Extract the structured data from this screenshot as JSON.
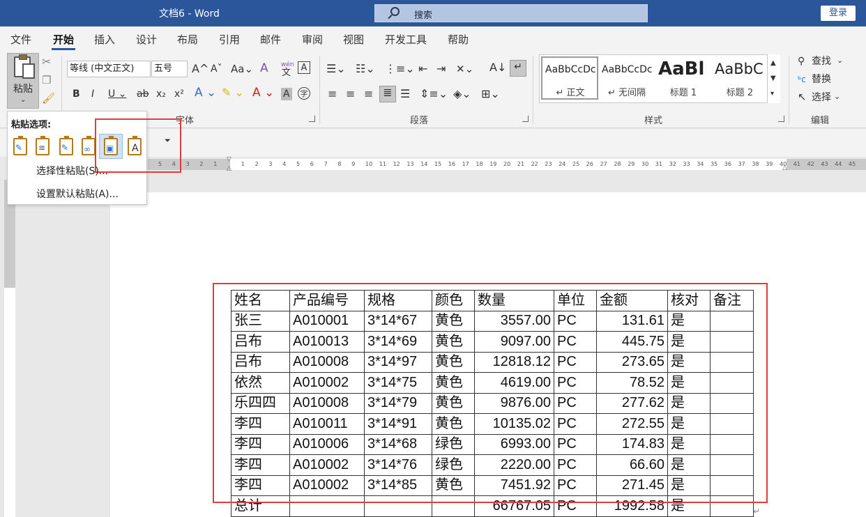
{
  "titlebar": {
    "title": "文档6  -  Word",
    "search_placeholder": "搜索",
    "login": "登录"
  },
  "tabs": [
    "文件",
    "开始",
    "插入",
    "设计",
    "布局",
    "引用",
    "邮件",
    "审阅",
    "视图",
    "开发工具",
    "帮助"
  ],
  "active_tab": "开始",
  "ribbon": {
    "paste_label": "粘贴",
    "font_name": "等线 (中文正文)",
    "font_size": "五号",
    "group_font": "字体",
    "group_paragraph": "段落",
    "group_styles": "样式",
    "group_edit": "编辑",
    "styles": [
      {
        "preview": "AaBbCcDc",
        "name": "↵ 正文"
      },
      {
        "preview": "AaBbCcDc",
        "name": "↵ 无间隔"
      },
      {
        "preview": "AaBl",
        "name": "标题 1"
      },
      {
        "preview": "AaBbC",
        "name": "标题 2"
      }
    ],
    "find": "查找",
    "replace": "替换",
    "select": "选择",
    "wen_label": "wén",
    "wen_char": "文"
  },
  "paste_menu": {
    "title": "粘贴选项:",
    "item_special": "选择性粘贴(S)...",
    "item_default": "设置默认粘贴(A)..."
  },
  "table": {
    "headers": [
      "姓名",
      "产品编号",
      "规格",
      "颜色",
      "数量",
      "单位",
      "金额",
      "核对",
      "备注"
    ],
    "rows": [
      [
        "张三",
        "A010001",
        "3*14*67",
        "黄色",
        "3557.00",
        "PC",
        "131.61",
        "是",
        ""
      ],
      [
        "吕布",
        "A010013",
        "3*14*69",
        "黄色",
        "9097.00",
        "PC",
        "445.75",
        "是",
        ""
      ],
      [
        "吕布",
        "A010008",
        "3*14*97",
        "黄色",
        "12818.12",
        "PC",
        "273.65",
        "是",
        ""
      ],
      [
        "依然",
        "A010002",
        "3*14*75",
        "黄色",
        "4619.00",
        "PC",
        "78.52",
        "是",
        ""
      ],
      [
        "乐四四",
        "A010008",
        "3*14*79",
        "黄色",
        "9876.00",
        "PC",
        "277.62",
        "是",
        ""
      ],
      [
        "李四",
        "A010011",
        "3*14*91",
        "黄色",
        "10135.02",
        "PC",
        "272.55",
        "是",
        ""
      ],
      [
        "李四",
        "A010006",
        "3*14*68",
        "绿色",
        "6993.00",
        "PC",
        "174.83",
        "是",
        ""
      ],
      [
        "李四",
        "A010002",
        "3*14*76",
        "绿色",
        "2220.00",
        "PC",
        "66.60",
        "是",
        ""
      ],
      [
        "李四",
        "A010002",
        "3*14*85",
        "黄色",
        "7451.92",
        "PC",
        "271.45",
        "是",
        ""
      ],
      [
        "总计",
        "",
        "",
        "",
        "66767.05",
        "PC",
        "1992.58",
        "是",
        ""
      ]
    ]
  },
  "colors": {
    "titlebar": "#2b579a",
    "highlight_box": "#e03c3c",
    "accent": "#2b579a"
  }
}
